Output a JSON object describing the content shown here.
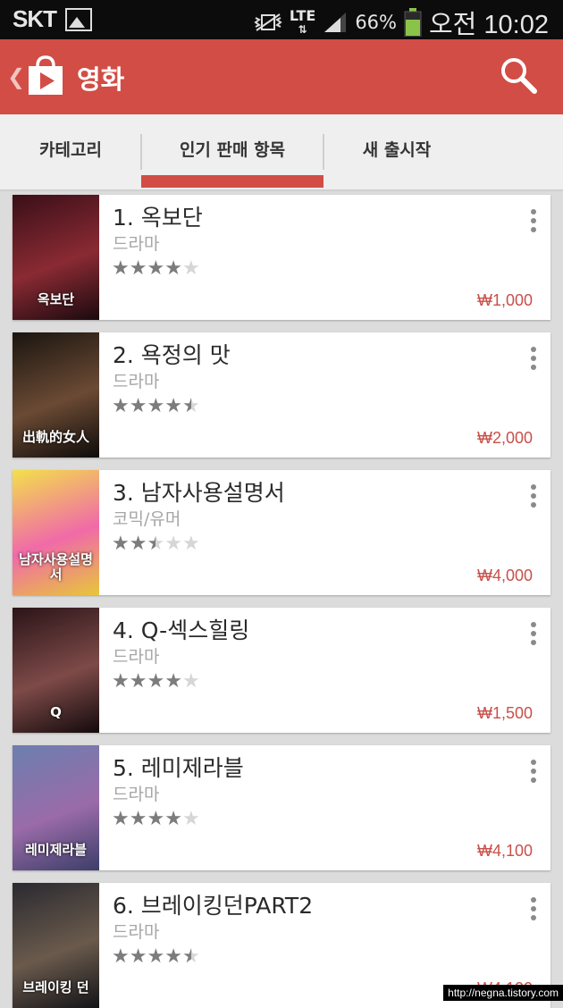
{
  "status_bar": {
    "carrier": "SKT",
    "network": "LTE",
    "battery_percent": "66%",
    "time": "오전 10:02"
  },
  "action_bar": {
    "title": "영화",
    "brand_color": "#d24d45"
  },
  "tabs": [
    {
      "label": "카테고리",
      "selected": false
    },
    {
      "label": "인기 판매 항목",
      "selected": true
    },
    {
      "label": "새 출시작",
      "selected": false
    }
  ],
  "movies": [
    {
      "title": "1. 옥보단",
      "genre": "드라마",
      "rating": 4.0,
      "price": "₩1,000",
      "poster_text": "옥보단",
      "poster_colors": [
        "#3a0f18",
        "#8a2a33",
        "#1a0a0e"
      ]
    },
    {
      "title": "2. 욕정의 맛",
      "genre": "드라마",
      "rating": 4.5,
      "price": "₩2,000",
      "poster_text": "出軌的女人",
      "poster_colors": [
        "#1a1510",
        "#6b4a34",
        "#0e0c0a"
      ]
    },
    {
      "title": "3. 남자사용설명서",
      "genre": "코믹/유머",
      "rating": 2.5,
      "price": "₩4,000",
      "poster_text": "남자사용설명서",
      "poster_colors": [
        "#f3e04a",
        "#f06aa8",
        "#e8c63a"
      ]
    },
    {
      "title": "4. Q-섹스힐링",
      "genre": "드라마",
      "rating": 4.0,
      "price": "₩1,500",
      "poster_text": "Q",
      "poster_colors": [
        "#2b1418",
        "#7d4a48",
        "#140a0c"
      ]
    },
    {
      "title": "5. 레미제라블",
      "genre": "드라마",
      "rating": 4.0,
      "price": "₩4,100",
      "poster_text": "레미제라블",
      "poster_colors": [
        "#6c7fb0",
        "#9a6ba8",
        "#3c3e6a"
      ]
    },
    {
      "title": "6. 브레이킹던PART2",
      "genre": "드라마",
      "rating": 4.5,
      "price": "₩4,100",
      "poster_text": "브레이킹 던",
      "poster_colors": [
        "#2a2a30",
        "#6a5a4c",
        "#141418"
      ]
    }
  ],
  "watermark": "http://negna.tistory.com"
}
